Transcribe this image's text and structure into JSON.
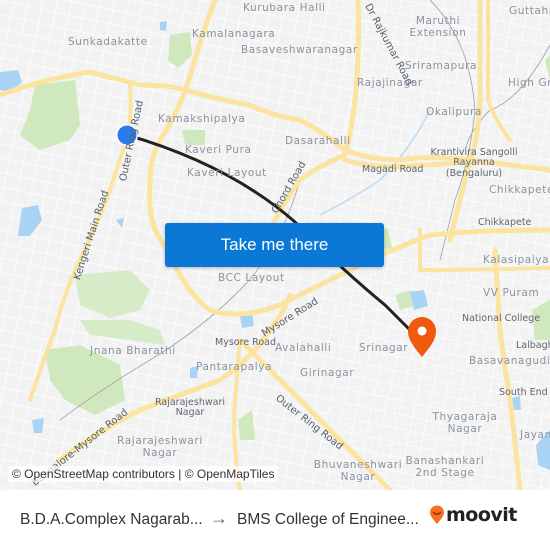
{
  "map": {
    "colors": {
      "background": "#f2f2f3",
      "major_road": "#fbe6a2",
      "park": "#c9e6b3",
      "water": "#a9d3f5",
      "route_line": "#222222",
      "origin_marker": "#2a7af0",
      "destination_marker": "#f05a0f"
    },
    "place_labels": [
      {
        "text": "Kurubara Halli"
      },
      {
        "text": "Sunkadakatte"
      },
      {
        "text": "Kamalanagara"
      },
      {
        "text": "Basaveshwaranagar"
      },
      {
        "text": "Maruthi Extension"
      },
      {
        "text": "Guttahalli"
      },
      {
        "text": "Sriramapura"
      },
      {
        "text": "Rajajinagar"
      },
      {
        "text": "High Grounds"
      },
      {
        "text": "Kamakshipalya"
      },
      {
        "text": "Okalipura"
      },
      {
        "text": "Dasarahalli"
      },
      {
        "text": "Kaveri Pura"
      },
      {
        "text": "Krantivira Sangolli Rayanna (Bengaluru)"
      },
      {
        "text": "Magadi Road"
      },
      {
        "text": "Kaveri Layout"
      },
      {
        "text": "Chikkapete"
      },
      {
        "text": "Chikkapete"
      },
      {
        "text": "Kalasipalya"
      },
      {
        "text": "BCC Layout"
      },
      {
        "text": "VV Puram"
      },
      {
        "text": "National College"
      },
      {
        "text": "Jnana Bharathi"
      },
      {
        "text": "Mysore Road"
      },
      {
        "text": "Avalahalli"
      },
      {
        "text": "Srinagar"
      },
      {
        "text": "Basavanagudi"
      },
      {
        "text": "Lalbagh"
      },
      {
        "text": "Pantarapalya"
      },
      {
        "text": "Girinagar"
      },
      {
        "text": "Rajarajeshwari Nagar"
      },
      {
        "text": "South End Circle"
      },
      {
        "text": "Thyagaraja Nagar"
      },
      {
        "text": "Rajarajeshwari Nagar"
      },
      {
        "text": "Jayanagar"
      },
      {
        "text": "Banashankari 2nd Stage"
      },
      {
        "text": "Bhuvaneshwari Nagar"
      }
    ],
    "road_labels": [
      {
        "text": "Outer Ring Road"
      },
      {
        "text": "Kengeri Main Road"
      },
      {
        "text": "Chord Road"
      },
      {
        "text": "Mysore Road"
      },
      {
        "text": "Outer Ring Road"
      },
      {
        "text": "Bangalore-Mysore Road"
      },
      {
        "text": "Dr Rajkumar Road"
      }
    ],
    "attribution": "© OpenStreetMap contributors | © OpenMapTiles"
  },
  "cta": {
    "label": "Take me there"
  },
  "footer": {
    "origin": "B.D.A.Complex Nagarab...",
    "arrow": "→",
    "destination": "BMS College of Enginee...",
    "brand": "moovit"
  }
}
